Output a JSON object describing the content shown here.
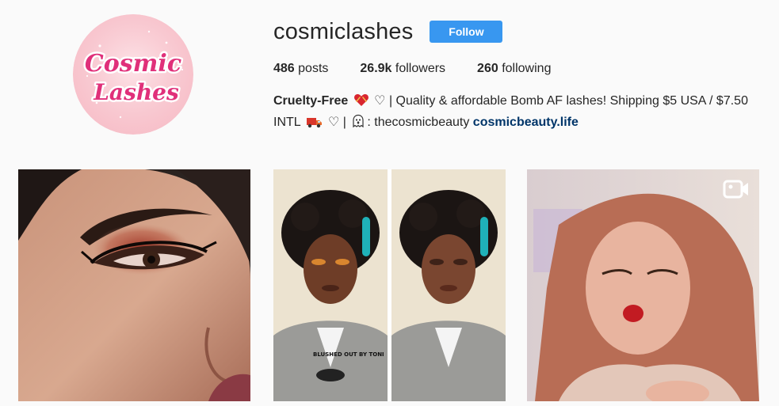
{
  "profile": {
    "username": "cosmiclashes",
    "follow_label": "Follow",
    "avatar_logo_line1": "Cosmic",
    "avatar_logo_line2": "Lashes"
  },
  "stats": {
    "posts_count": "486",
    "posts_label": "posts",
    "followers_count": "26.9k",
    "followers_label": "followers",
    "following_count": "260",
    "following_label": "following"
  },
  "bio": {
    "name": "Cruelty-Free",
    "text_part1": "♡ | Quality & affordable Bomb AF lashes! Shipping $5 USA / $7.50 INTL",
    "text_part2": "♡ |",
    "text_part3": ": thecosmicbeauty",
    "link": "cosmicbeauty.life"
  },
  "posts": [
    {
      "name": "closeup-eye-makeup",
      "is_video": false
    },
    {
      "name": "before-after-makeup",
      "is_video": false,
      "overlay_text": "BLUSHED OUT BY TONI"
    },
    {
      "name": "kiss-blowing-video",
      "is_video": true
    }
  ],
  "colors": {
    "follow_button": "#3897f0",
    "link": "#003569",
    "avatar_bg": "#f8c7cf",
    "logo_pink": "#e0307a",
    "background": "#fafafa"
  }
}
